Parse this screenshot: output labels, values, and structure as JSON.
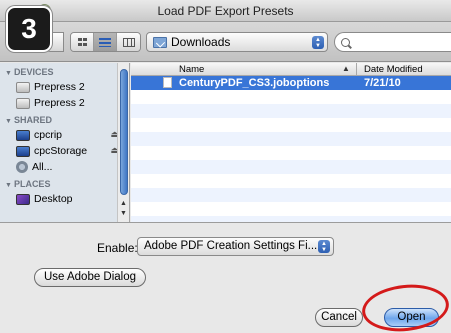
{
  "window": {
    "title": "Load PDF Export Presets"
  },
  "badge": {
    "step": "3"
  },
  "toolbar": {
    "location": "Downloads",
    "view_modes": [
      "icon-view",
      "list-view",
      "column-view"
    ],
    "active_view": "list-view"
  },
  "sidebar": {
    "sections": [
      {
        "title": "DEVICES",
        "items": [
          {
            "label": "Prepress 2",
            "icon": "disk-icon"
          },
          {
            "label": "Prepress 2",
            "icon": "disk-icon"
          }
        ]
      },
      {
        "title": "SHARED",
        "items": [
          {
            "label": "cpcrip",
            "icon": "monitor-icon",
            "eject": true
          },
          {
            "label": "cpcStorage",
            "icon": "monitor-icon",
            "eject": true
          },
          {
            "label": "All...",
            "icon": "network-icon"
          }
        ]
      },
      {
        "title": "PLACES",
        "items": [
          {
            "label": "Desktop",
            "icon": "desktop-icon"
          }
        ]
      }
    ]
  },
  "filelist": {
    "columns": {
      "name": "Name",
      "date": "Date Modified"
    },
    "rows": [
      {
        "name": "CenturyPDF_CS3.joboptions",
        "date": "7/21/10",
        "selected": true
      }
    ]
  },
  "bottom": {
    "enable_label": "Enable:",
    "enable_value": "Adobe PDF Creation Settings Fi...",
    "adobe_dialog_button": "Use Adobe Dialog",
    "cancel_button": "Cancel",
    "open_button": "Open"
  },
  "colors": {
    "selection": "#3875d7",
    "highlight_ring": "#d41a1a",
    "badge_bg": "#1b1b1b"
  }
}
